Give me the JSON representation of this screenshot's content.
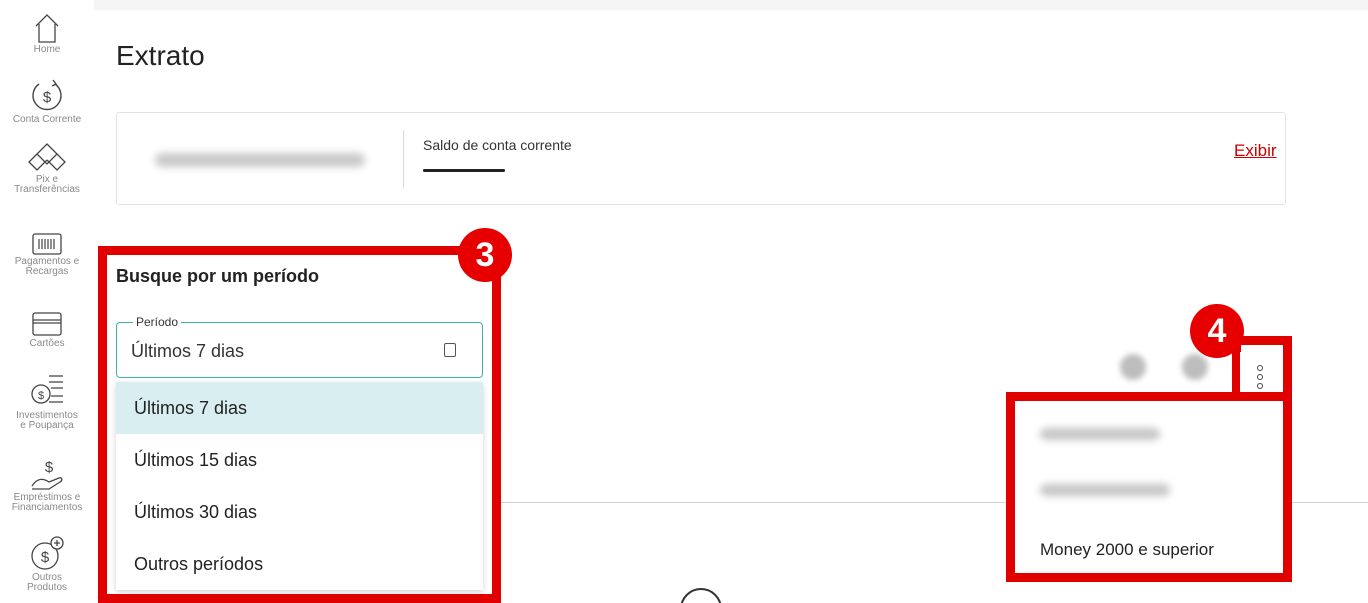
{
  "sidebar": {
    "items": [
      {
        "label": "Home",
        "icon": "home-icon"
      },
      {
        "label": "Conta Corrente",
        "icon": "dollar-refresh-icon"
      },
      {
        "label": "Pix e\nTransferências",
        "icon": "pix-icon"
      },
      {
        "label": "Pagamentos e\nRecargas",
        "icon": "barcode-icon"
      },
      {
        "label": "Cartões",
        "icon": "card-icon"
      },
      {
        "label": "Investimentos\ne Poupança",
        "icon": "investment-icon"
      },
      {
        "label": "Empréstimos e\nFinanciamentos",
        "icon": "loan-hand-icon"
      },
      {
        "label": "Outros\nProdutos",
        "icon": "dollar-plus-icon"
      }
    ]
  },
  "page": {
    "title": "Extrato"
  },
  "balance_card": {
    "label": "Saldo de conta corrente",
    "show_link": "Exibir"
  },
  "period": {
    "badge": "3",
    "title": "Busque por um período",
    "field_label": "Período",
    "field_value": "Últimos 7 dias",
    "options": [
      "Últimos 7 dias",
      "Últimos 15 dias",
      "Últimos 30 dias",
      "Outros períodos"
    ],
    "selected_index": 0
  },
  "menu": {
    "badge": "4",
    "visible_item": "Money 2000 e superior"
  },
  "colors": {
    "highlight": "#e00000",
    "selected_option": "#d9eef0",
    "field_border": "#3fb3a7",
    "link": "#cc0000"
  }
}
